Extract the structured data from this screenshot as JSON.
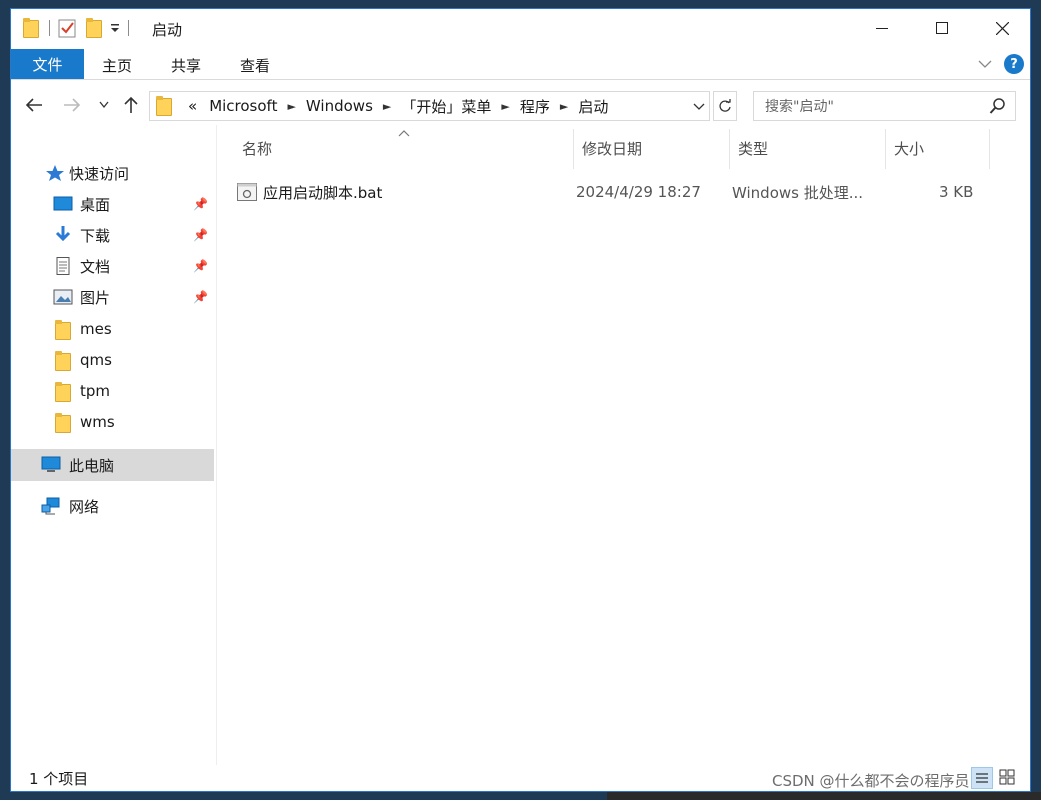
{
  "window": {
    "title": "启动"
  },
  "ribbon": {
    "tab_file": "文件",
    "tabs": [
      "主页",
      "共享",
      "查看"
    ],
    "help_icon": "?"
  },
  "address": {
    "overflow": "«",
    "crumbs": [
      "Microsoft",
      "Windows",
      "「开始」菜单",
      "程序",
      "启动"
    ]
  },
  "search": {
    "placeholder": "搜索\"启动\""
  },
  "nav": {
    "quick_access": "快速访问",
    "items": [
      {
        "label": "桌面",
        "icon": "desktop-icon",
        "pinned": true
      },
      {
        "label": "下载",
        "icon": "download-icon",
        "pinned": true
      },
      {
        "label": "文档",
        "icon": "document-icon",
        "pinned": true
      },
      {
        "label": "图片",
        "icon": "pictures-icon",
        "pinned": true
      },
      {
        "label": "mes",
        "icon": "folder-icon",
        "pinned": false
      },
      {
        "label": "qms",
        "icon": "folder-icon",
        "pinned": false
      },
      {
        "label": "tpm",
        "icon": "folder-icon",
        "pinned": false
      },
      {
        "label": "wms",
        "icon": "folder-icon",
        "pinned": false
      }
    ],
    "this_pc": "此电脑",
    "network": "网络"
  },
  "columns": {
    "name": "名称",
    "modified": "修改日期",
    "type": "类型",
    "size": "大小"
  },
  "files": [
    {
      "name": "应用启动脚本.bat",
      "modified": "2024/4/29 18:27",
      "type": "Windows 批处理...",
      "size": "3 KB"
    }
  ],
  "status": {
    "item_count": "1 个项目"
  },
  "watermark": "CSDN @什么都不会の程序员",
  "colors": {
    "accent": "#1979ca",
    "folder": "#ffd35a",
    "selected_bg": "#d9d9d9"
  }
}
